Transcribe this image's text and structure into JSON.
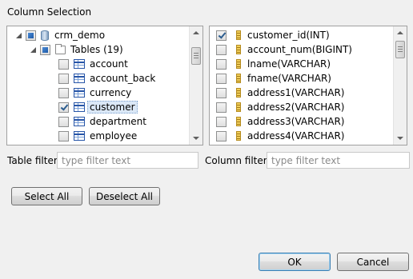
{
  "dialog": {
    "title": "Column Selection"
  },
  "tables_tree": {
    "root": {
      "label": "crm_demo",
      "state": "partial"
    },
    "group": {
      "label": "Tables (19)",
      "state": "partial"
    },
    "items": [
      {
        "label": "account",
        "checked": false,
        "selected": false
      },
      {
        "label": "account_back",
        "checked": false,
        "selected": false
      },
      {
        "label": "currency",
        "checked": false,
        "selected": false
      },
      {
        "label": "customer",
        "checked": true,
        "selected": true
      },
      {
        "label": "department",
        "checked": false,
        "selected": false
      },
      {
        "label": "employee",
        "checked": false,
        "selected": false
      }
    ]
  },
  "columns_list": {
    "items": [
      {
        "label": "customer_id(INT)",
        "checked": true
      },
      {
        "label": "account_num(BIGINT)",
        "checked": false
      },
      {
        "label": "lname(VARCHAR)",
        "checked": false
      },
      {
        "label": "fname(VARCHAR)",
        "checked": false
      },
      {
        "label": "address1(VARCHAR)",
        "checked": false
      },
      {
        "label": "address2(VARCHAR)",
        "checked": false
      },
      {
        "label": "address3(VARCHAR)",
        "checked": false
      },
      {
        "label": "address4(VARCHAR)",
        "checked": false
      }
    ]
  },
  "filters": {
    "table_label": "Table filter:",
    "table_placeholder": "type filter text",
    "table_value": "",
    "column_label": "Column filter:",
    "column_placeholder": "type filter text",
    "column_value": ""
  },
  "buttons": {
    "select_all": "Select All",
    "deselect_all": "Deselect All",
    "ok": "OK",
    "cancel": "Cancel"
  }
}
